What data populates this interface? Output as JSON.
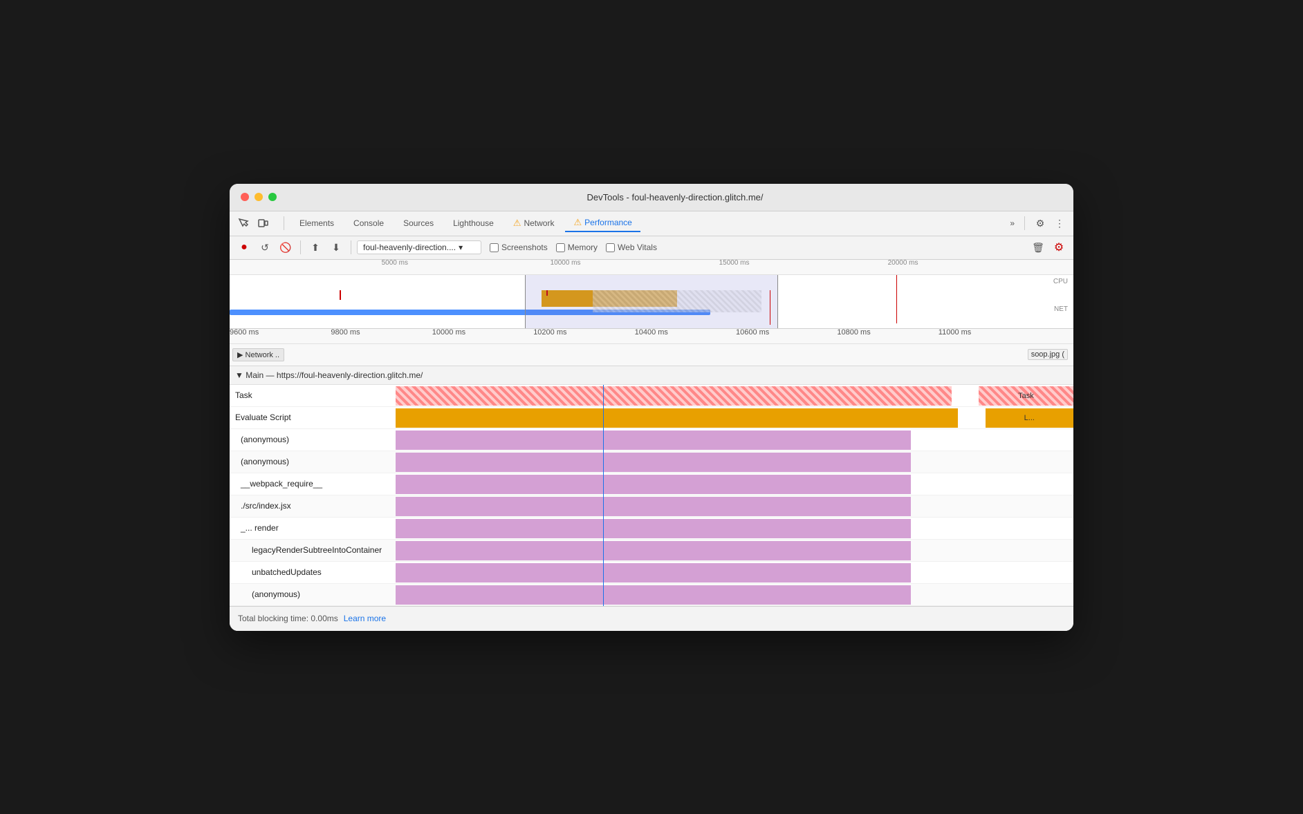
{
  "window": {
    "title": "DevTools - foul-heavenly-direction.glitch.me/"
  },
  "nav": {
    "tabs": [
      {
        "label": "Elements",
        "active": false
      },
      {
        "label": "Console",
        "active": false
      },
      {
        "label": "Sources",
        "active": false
      },
      {
        "label": "Lighthouse",
        "active": false
      },
      {
        "label": "Network",
        "active": false,
        "warning": true
      },
      {
        "label": "Performance",
        "active": true,
        "warning": true
      }
    ],
    "more_btn": "»"
  },
  "toolbar": {
    "record_label": "⏺",
    "reload_label": "↺",
    "clear_label": "🚫",
    "upload_label": "⬆",
    "download_label": "⬇",
    "url_value": "foul-heavenly-direction....",
    "screenshots_label": "Screenshots",
    "memory_label": "Memory",
    "web_vitals_label": "Web Vitals",
    "settings_label": "⚙",
    "more_label": "⋮"
  },
  "timeline": {
    "ruler_marks": [
      "5000 ms",
      "10000 ms",
      "15000 ms",
      "20000 ms"
    ],
    "cpu_label": "CPU",
    "net_label": "NET"
  },
  "detail_ruler": {
    "marks": [
      "9600 ms",
      "9800 ms",
      "10000 ms",
      "10200 ms",
      "10400 ms",
      "10600 ms",
      "10800 ms",
      "11000 ms"
    ]
  },
  "network_lane": {
    "label": "▶ Network ..",
    "file_label": "soop.jpg ("
  },
  "flame": {
    "header": "▼ Main — https://foul-heavenly-direction.glitch.me/",
    "rows": [
      {
        "label": "Task",
        "indent": 0,
        "type": "task",
        "extra": "Task"
      },
      {
        "label": "Evaluate Script",
        "indent": 0,
        "type": "evaluate",
        "extra": "L..."
      },
      {
        "label": "(anonymous)",
        "indent": 1,
        "type": "anon"
      },
      {
        "label": "(anonymous)",
        "indent": 1,
        "type": "anon"
      },
      {
        "label": "__webpack_require__",
        "indent": 1,
        "type": "anon"
      },
      {
        "label": "./src/index.jsx",
        "indent": 1,
        "type": "anon"
      },
      {
        "label": "_...    render",
        "indent": 1,
        "type": "anon"
      },
      {
        "label": "legacyRenderSubtreeIntoContainer",
        "indent": 2,
        "type": "anon"
      },
      {
        "label": "unbatchedUpdates",
        "indent": 2,
        "type": "anon"
      },
      {
        "label": "(anonymous)",
        "indent": 2,
        "type": "anon"
      }
    ]
  },
  "status_bar": {
    "blocking_time": "Total blocking time: 0.00ms",
    "learn_more": "Learn more"
  }
}
